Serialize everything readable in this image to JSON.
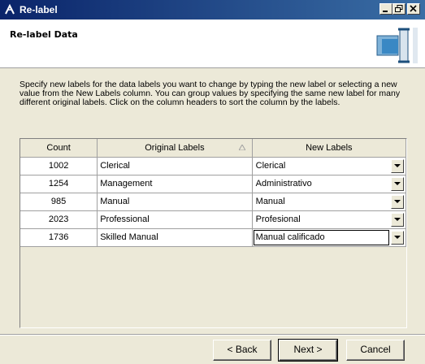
{
  "window": {
    "title": "Re-label",
    "controls": [
      "minimize-icon",
      "restore-icon",
      "close-icon"
    ]
  },
  "header": {
    "title": "Re-label Data",
    "icon": "relabel-wizard-icon"
  },
  "description": "Specify new labels for the data labels you want to change by typing the new label or selecting a new value from the New Labels column. You can group values by specifying the same new label for many different original labels.  Click on the column headers to sort the column by the labels.",
  "grid": {
    "columns": [
      "Count",
      "Original Labels",
      "New Labels"
    ],
    "sorted_column": "Original Labels",
    "rows": [
      {
        "count": "1002",
        "original": "Clerical",
        "new": "Clerical"
      },
      {
        "count": "1254",
        "original": "Management",
        "new": "Administrativo"
      },
      {
        "count": "985",
        "original": "Manual",
        "new": "Manual"
      },
      {
        "count": "2023",
        "original": "Professional",
        "new": "Profesional"
      },
      {
        "count": "1736",
        "original": "Skilled Manual",
        "new": "Manual calificado"
      }
    ]
  },
  "buttons": {
    "back": "< Back",
    "next": "Next >",
    "cancel": "Cancel"
  },
  "colors": {
    "titlebar": "#0a246a",
    "dialog_bg": "#ece9d8",
    "header_bg": "#ffffff"
  }
}
